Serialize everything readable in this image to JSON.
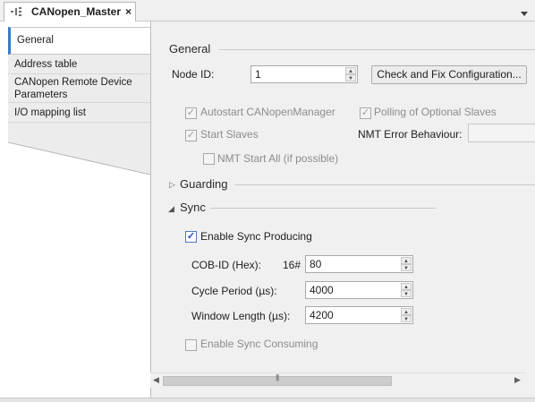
{
  "document_tab": {
    "title": "CANopen_Master",
    "close": "×",
    "icon": "device-tab-icon"
  },
  "tab_menu_icon": "▾",
  "nav": {
    "items": [
      {
        "label": "General",
        "selected": true
      },
      {
        "label": "Address table"
      },
      {
        "label": "CANopen Remote Device Parameters"
      },
      {
        "label": "I/O mapping list"
      }
    ]
  },
  "general": {
    "heading": "General",
    "node_id_label": "Node ID:",
    "node_id_value": "1",
    "check_fix_button": "Check and Fix Configuration...",
    "autostart_label": "Autostart CANopenManager",
    "polling_label": "Polling of Optional Slaves",
    "start_slaves_label": "Start Slaves",
    "nmt_error_label": "NMT Error Behaviour:",
    "nmt_start_all_label": "NMT Start All (if possible)"
  },
  "guarding": {
    "heading": "Guarding",
    "expander": "▷"
  },
  "sync": {
    "heading": "Sync",
    "expander": "◢",
    "enable_producing_label": "Enable Sync Producing",
    "cob_id_label": "COB-ID (Hex):",
    "cob_id_prefix": "16#",
    "cob_id_value": "80",
    "cycle_period_label": "Cycle Period (µs):",
    "cycle_period_value": "4000",
    "window_length_label": "Window Length (µs):",
    "window_length_value": "4200",
    "enable_consuming_label": "Enable Sync Consuming"
  },
  "scrollbar": {
    "left": "◀",
    "right": "▶",
    "grip": "|||"
  },
  "check_mark": "✓",
  "colors": {
    "accent": "#3a7ac8",
    "panel": "#f0f0f0",
    "checked": "#2151a3"
  }
}
